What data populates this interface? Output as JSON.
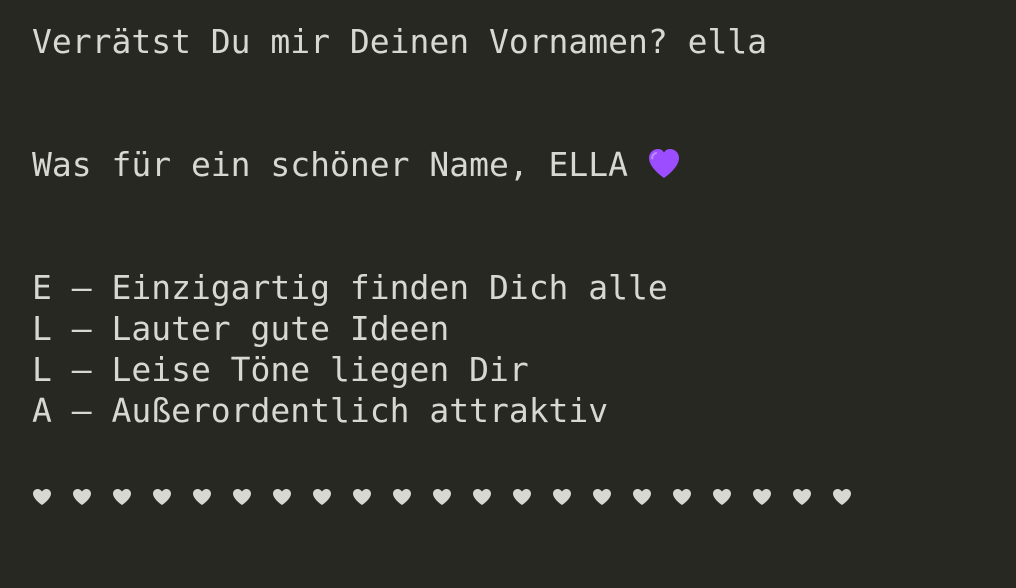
{
  "terminal": {
    "prompt_question": "Verrätst Du mir Deinen Vornamen?",
    "prompt_answer": "ella",
    "greeting_text": "Was für ein schöner Name, ELLA",
    "greeting_icon": "purple-heart-icon",
    "acrostic": [
      "E – Einzigartig finden Dich alle",
      "L – Lauter gute Ideen",
      "L – Leise Töne liegen Dir",
      "A – Außerordentlich attraktiv"
    ],
    "hearts_count": 21,
    "hearts_icon": "heart-icon",
    "colors": {
      "background": "#272822",
      "text": "#d8d8d2",
      "purple_heart": "#9b4dff"
    }
  }
}
